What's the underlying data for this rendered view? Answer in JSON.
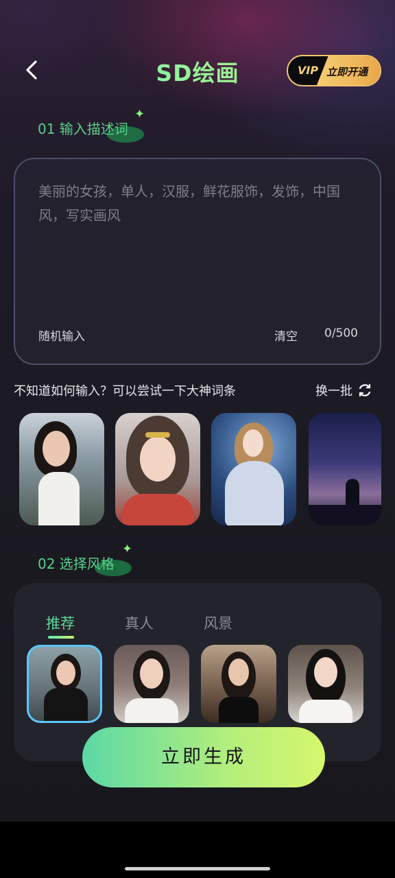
{
  "header": {
    "title": "SD绘画",
    "vip_label": "VIP",
    "vip_cta": "立即开通"
  },
  "section1": {
    "label": "01 输入描述词",
    "prompt_text": "美丽的女孩，单人，汉服，鲜花服饰，发饰，中国风，写实画风",
    "random_input": "随机输入",
    "clear": "清空",
    "char_count": "0/500"
  },
  "suggestions": {
    "hint": "不知道如何输入？可以尝试一下大神词条",
    "refresh": "换一批"
  },
  "section2": {
    "label": "02 选择风格",
    "tabs": [
      "推荐",
      "真人",
      "风景"
    ],
    "active_tab": "推荐"
  },
  "generate_button": "立即生成",
  "colors": {
    "accent_green": "#57d28a",
    "gradient_start": "#5bd8a6",
    "gradient_end": "#d6f76b",
    "vip_gold": "#f2c56a",
    "selected_border": "#5cc7ff"
  }
}
